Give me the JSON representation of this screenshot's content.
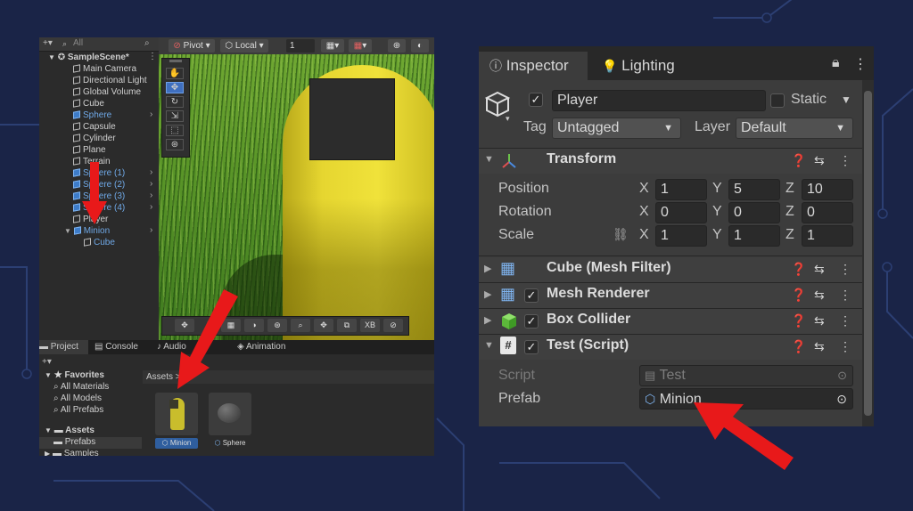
{
  "hierarchy": {
    "search_placeholder": "All",
    "scene_name": "SampleScene*",
    "items": [
      {
        "label": "Main Camera",
        "blue": false
      },
      {
        "label": "Directional Light",
        "blue": false
      },
      {
        "label": "Global Volume",
        "blue": false
      },
      {
        "label": "Cube",
        "blue": false
      },
      {
        "label": "Sphere",
        "blue": true
      },
      {
        "label": "Capsule",
        "blue": false
      },
      {
        "label": "Cylinder",
        "blue": false
      },
      {
        "label": "Plane",
        "blue": false
      },
      {
        "label": "Terrain",
        "blue": false
      },
      {
        "label": "Sphere (1)",
        "blue": true
      },
      {
        "label": "Sphere (2)",
        "blue": true
      },
      {
        "label": "Sphere (3)",
        "blue": true
      },
      {
        "label": "Sphere (4)",
        "blue": true
      },
      {
        "label": "Player",
        "blue": false
      },
      {
        "label": "Minion",
        "blue": true
      },
      {
        "label": "Cube",
        "blue": true
      }
    ]
  },
  "scene_toolbar": {
    "pivot": "Pivot",
    "local": "Local",
    "grid_value": "1",
    "xb": "XB"
  },
  "bottom_tabs": {
    "project": "Project",
    "console": "Console",
    "audio": "Audio",
    "animation": "Animation"
  },
  "project": {
    "favorites": "Favorites",
    "all_materials": "All Materials",
    "all_models": "All Models",
    "all_prefabs": "All Prefabs",
    "assets": "Assets",
    "prefabs": "Prefabs",
    "samples": "Samples",
    "breadcrumb": "Assets",
    "breadcrumb_sep": ">",
    "asset_items": [
      "Minion",
      "Sphere"
    ]
  },
  "inspector": {
    "tab_inspector": "Inspector",
    "tab_lighting": "Lighting",
    "object_name": "Player",
    "static_label": "Static",
    "tag_label": "Tag",
    "tag_value": "Untagged",
    "layer_label": "Layer",
    "layer_value": "Default",
    "transform": {
      "title": "Transform",
      "position_label": "Position",
      "rotation_label": "Rotation",
      "scale_label": "Scale",
      "position": {
        "x": "1",
        "y": "5",
        "z": "10"
      },
      "rotation": {
        "x": "0",
        "y": "0",
        "z": "0"
      },
      "scale": {
        "x": "1",
        "y": "1",
        "z": "1"
      },
      "axis_x": "X",
      "axis_y": "Y",
      "axis_z": "Z"
    },
    "components": {
      "mesh_filter": "Cube (Mesh Filter)",
      "mesh_renderer": "Mesh Renderer",
      "box_collider": "Box Collider",
      "test_script": "Test (Script)"
    },
    "script_label": "Script",
    "script_value": "Test",
    "prefab_label": "Prefab",
    "prefab_value": "Minion"
  },
  "colors": {
    "background": "#1a2447",
    "arrow": "#e8191a",
    "selection_blue": "#3f6fbf",
    "minion_yellow": "#e6d630"
  }
}
